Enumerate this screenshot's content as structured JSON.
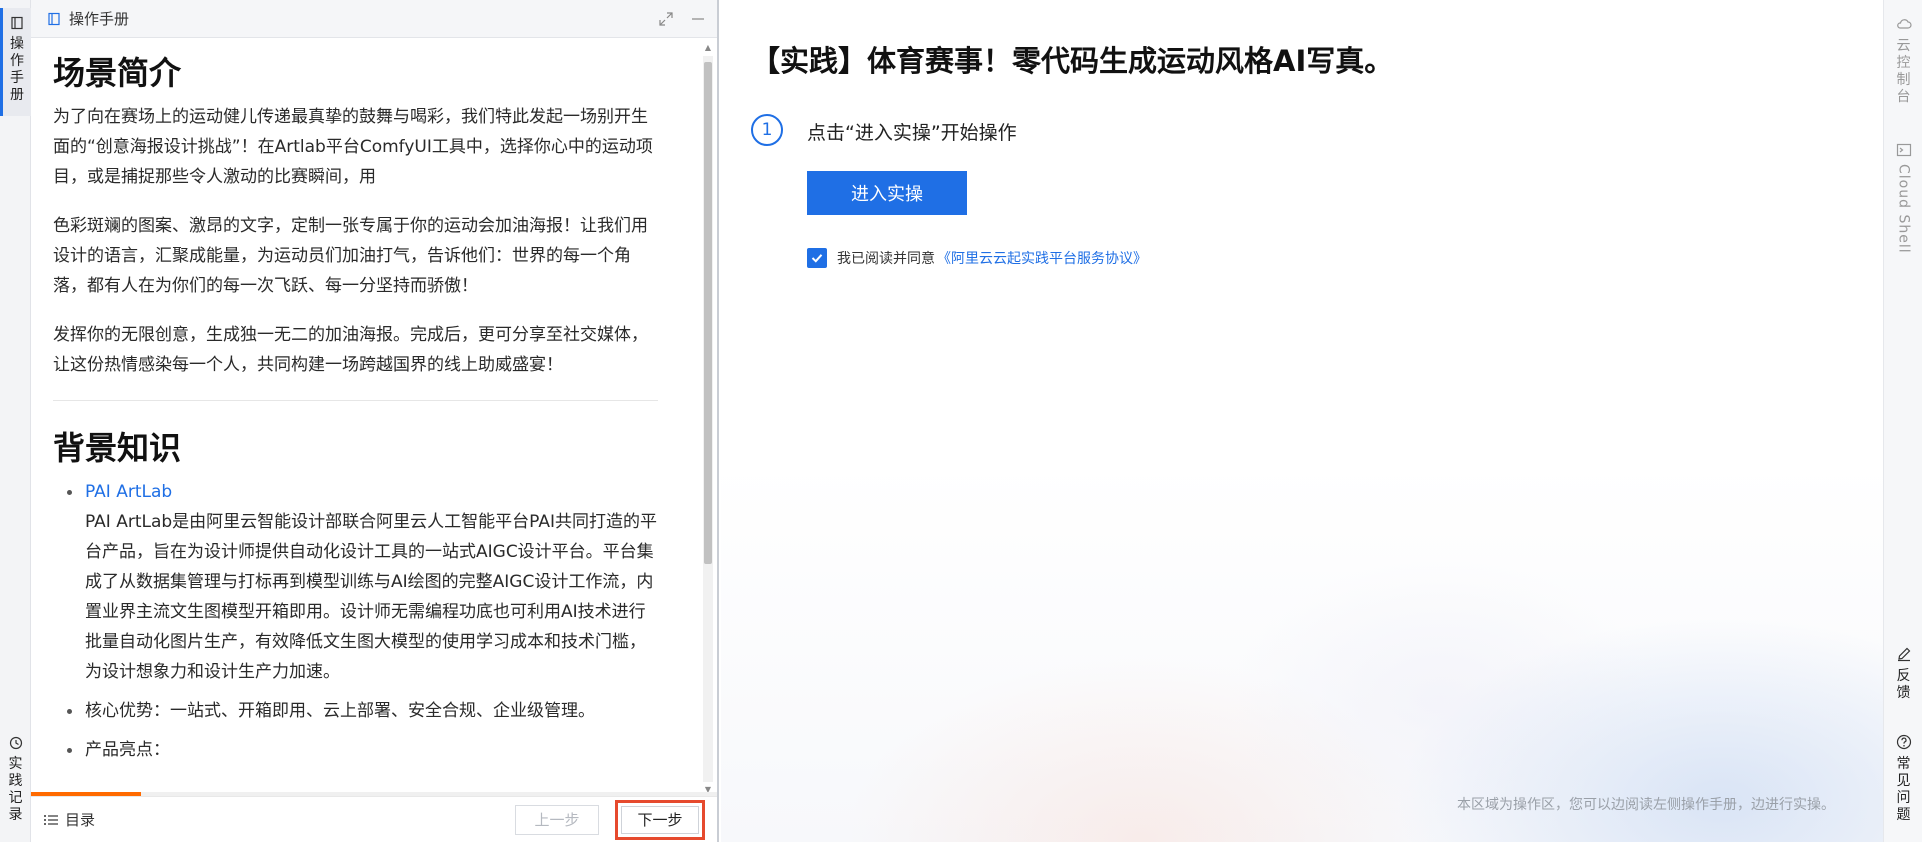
{
  "left_rail": {
    "manual_label": "操作手册",
    "records_label": "实践记录"
  },
  "manual": {
    "header_title": "操作手册",
    "section1_title": "场景简介",
    "section1_paragraphs": [
      "为了向在赛场上的运动健儿传递最真挚的鼓舞与喝彩，我们特此发起一场别开生面的“创意海报设计挑战”！在Artlab平台ComfyUI工具中，选择你心中的运动项目，或是捕捉那些令人激动的比赛瞬间，用",
      "色彩斑斓的图案、激昂的文字，定制一张专属于你的运动会加油海报！让我们用设计的语言，汇聚成能量，为运动员们加油打气，告诉他们：世界的每一个角落，都有人在为你们的每一次飞跃、每一分坚持而骄傲！",
      "发挥你的无限创意，生成独一无二的加油海报。完成后，更可分享至社交媒体，让这份热情感染每一个人，共同构建一场跨越国界的线上助威盛宴！"
    ],
    "section2_title": "背景知识",
    "bullet1_link": "PAI ArtLab",
    "bullet1_text": "PAI ArtLab是由阿里云智能设计部联合阿里云人工智能平台PAI共同打造的平台产品，旨在为设计师提供自动化设计工具的一站式AIGC设计平台。平台集成了从数据集管理与打标再到模型训练与AI绘图的完整AIGC设计工作流，内置业界主流文生图模型开箱即用。设计师无需编程功底也可利用AI技术进行批量自动化图片生产，有效降低文生图大模型的使用学习成本和技术门槛，为设计想象力和设计生产力加速。",
    "bullet2_text": "核心优势：一站式、开箱即用、云上部署、安全合规、企业级管理。",
    "bullet3_text": "产品亮点：",
    "progress_fraction": 0.16
  },
  "footer": {
    "toc_label": "目录",
    "prev_label": "上一步",
    "next_label": "下一步"
  },
  "main": {
    "title": "【实践】体育赛事！零代码生成运动风格AI写真。",
    "step_number": "1",
    "step_text": "点击“进入实操”开始操作",
    "enter_button": "进入实操",
    "agree_text": "我已阅读并同意",
    "agree_link": "《阿里云云起实践平台服务协议》",
    "hint": "本区域为操作区，您可以边阅读左侧操作手册，边进行实操。"
  },
  "right_rail": {
    "console_label": "云控制台",
    "cloud_shell_label": "Cloud Shell",
    "feedback_label": "反馈",
    "faq_label": "常见问题"
  },
  "colors": {
    "accent": "#1f6fe5",
    "progress": "#ff6a00",
    "highlight_border": "#e64a2e"
  }
}
